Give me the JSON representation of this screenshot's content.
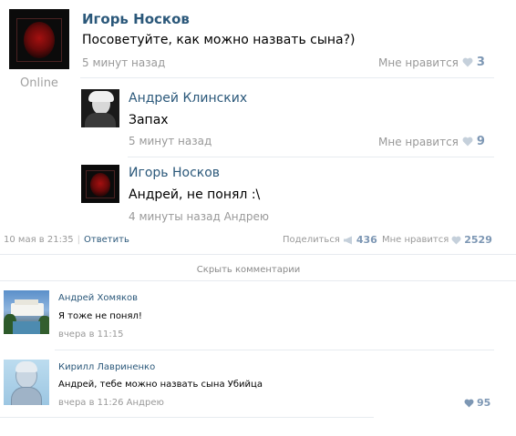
{
  "post": {
    "author": "Игорь Носков",
    "text": "Посоветуйте, как можно назвать сына?)",
    "time": "5 минут назад",
    "like_label": "Мне нравится",
    "like_count": "3",
    "status": "Online"
  },
  "replies": [
    {
      "author": "Андрей Клинских",
      "text": "Запах",
      "time": "5 минут назад",
      "like_label": "Мне нравится",
      "like_count": "9"
    },
    {
      "author": "Игорь Носков",
      "text": "Андрей, не понял :\\",
      "time": "4 минуты назад Андрею"
    }
  ],
  "footer": {
    "date": "10 мая в 21:35",
    "reply_link": "Ответить",
    "share_label": "Поделиться",
    "share_count": "436",
    "like_label": "Мне нравится",
    "like_count": "2529"
  },
  "hide_comments": "Скрыть комментарии",
  "comments": [
    {
      "author": "Андрей Хомяков",
      "text": "Я тоже не понял!",
      "time": "вчера в 11:15"
    },
    {
      "author": "Кирилл Лавриненко",
      "text": "Андрей, тебе можно назвать сына Убийца",
      "time": "вчера в 11:26 Андрею",
      "like_count": "95"
    }
  ],
  "colors": {
    "link": "#2b587a",
    "meta": "#999999",
    "separator": "#e7ebf0"
  }
}
